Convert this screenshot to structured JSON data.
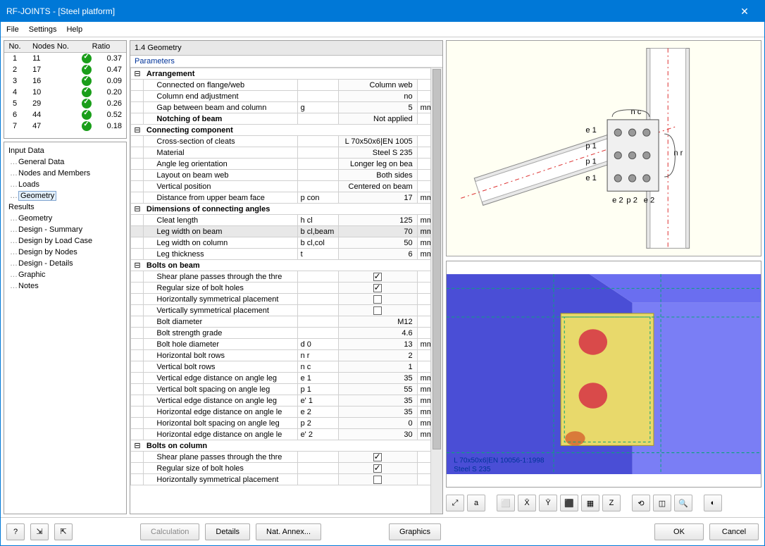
{
  "title": "RF-JOINTS - [Steel platform]",
  "close": "✕",
  "menu": {
    "file": "File",
    "settings": "Settings",
    "help": "Help"
  },
  "nodes_header": {
    "no": "No.",
    "nodes": "Nodes No.",
    "ratio": "Ratio"
  },
  "nodes": [
    {
      "no": "1",
      "nn": "11",
      "ratio": "0.37"
    },
    {
      "no": "2",
      "nn": "17",
      "ratio": "0.47"
    },
    {
      "no": "3",
      "nn": "16",
      "ratio": "0.09"
    },
    {
      "no": "4",
      "nn": "10",
      "ratio": "0.20"
    },
    {
      "no": "5",
      "nn": "29",
      "ratio": "0.26"
    },
    {
      "no": "6",
      "nn": "44",
      "ratio": "0.52"
    },
    {
      "no": "7",
      "nn": "47",
      "ratio": "0.18"
    }
  ],
  "tree": {
    "input": "Input Data",
    "input_items": [
      "General Data",
      "Nodes and Members",
      "Loads",
      "Geometry"
    ],
    "results": "Results",
    "result_items": [
      "Geometry",
      "Design - Summary",
      "Design by Load Case",
      "Design by Nodes",
      "Design - Details",
      "Graphic",
      "Notes"
    ],
    "selected": "Geometry"
  },
  "section_title": "1.4 Geometry",
  "params_label": "Parameters",
  "rows": [
    {
      "type": "group",
      "label": "Arrangement"
    },
    {
      "type": "row",
      "label": "Connected on flange/web",
      "sym": "",
      "val": "Column web",
      "unit": ""
    },
    {
      "type": "row",
      "label": "Column end adjustment",
      "sym": "",
      "val": "no",
      "unit": ""
    },
    {
      "type": "row",
      "label": "Gap between beam and column",
      "sym": "g",
      "val": "5",
      "unit": "mm"
    },
    {
      "type": "row",
      "label": "Notching of beam",
      "bold": true,
      "sym": "",
      "val": "Not applied",
      "unit": ""
    },
    {
      "type": "group",
      "label": "Connecting component"
    },
    {
      "type": "row",
      "label": "Cross-section of cleats",
      "sym": "",
      "val": "L 70x50x6|EN 1005",
      "unit": ""
    },
    {
      "type": "row",
      "label": "Material",
      "sym": "",
      "val": "Steel S 235",
      "unit": ""
    },
    {
      "type": "row",
      "label": "Angle leg orientation",
      "sym": "",
      "val": "Longer leg on bea",
      "unit": ""
    },
    {
      "type": "row",
      "label": "Layout on beam web",
      "sym": "",
      "val": "Both sides",
      "unit": ""
    },
    {
      "type": "row",
      "label": "Vertical position",
      "sym": "",
      "val": "Centered on beam",
      "unit": ""
    },
    {
      "type": "row",
      "label": "Distance from upper beam face",
      "sym": "p con",
      "val": "17",
      "unit": "mm"
    },
    {
      "type": "group",
      "label": "Dimensions of connecting angles"
    },
    {
      "type": "row",
      "label": "Cleat length",
      "sym": "h cl",
      "val": "125",
      "unit": "mm"
    },
    {
      "type": "row",
      "label": "Leg width on beam",
      "sym": "b cl,beam",
      "val": "70",
      "unit": "mm",
      "hl": true
    },
    {
      "type": "row",
      "label": "Leg width on column",
      "sym": "b cl,col",
      "val": "50",
      "unit": "mm"
    },
    {
      "type": "row",
      "label": "Leg thickness",
      "sym": "t",
      "val": "6",
      "unit": "mm"
    },
    {
      "type": "group",
      "label": "Bolts on beam"
    },
    {
      "type": "check",
      "label": "Shear plane passes through the thre",
      "checked": true
    },
    {
      "type": "check",
      "label": "Regular size of bolt holes",
      "checked": true
    },
    {
      "type": "check",
      "label": "Horizontally symmetrical placement",
      "checked": false
    },
    {
      "type": "check",
      "label": "Vertically symmetrical placement",
      "checked": false
    },
    {
      "type": "row",
      "label": "Bolt diameter",
      "sym": "",
      "val": "M12",
      "unit": ""
    },
    {
      "type": "row",
      "label": "Bolt strength grade",
      "sym": "",
      "val": "4.6",
      "unit": ""
    },
    {
      "type": "row",
      "label": "Bolt hole diameter",
      "sym": "d 0",
      "val": "13",
      "unit": "mm"
    },
    {
      "type": "row",
      "label": "Horizontal bolt rows",
      "sym": "n r",
      "val": "2",
      "unit": ""
    },
    {
      "type": "row",
      "label": "Vertical bolt rows",
      "sym": "n c",
      "val": "1",
      "unit": ""
    },
    {
      "type": "row",
      "label": "Vertical edge distance on angle leg",
      "sym": "e 1",
      "val": "35",
      "unit": "mm"
    },
    {
      "type": "row",
      "label": "Vertical bolt spacing on angle leg",
      "sym": "p 1",
      "val": "55",
      "unit": "mm"
    },
    {
      "type": "row",
      "label": "Vertical edge distance on angle leg",
      "sym": "e' 1",
      "val": "35",
      "unit": "mm"
    },
    {
      "type": "row",
      "label": "Horizontal edge distance on angle le",
      "sym": "e 2",
      "val": "35",
      "unit": "mm"
    },
    {
      "type": "row",
      "label": "Horizontal bolt spacing on angle leg",
      "sym": "p 2",
      "val": "0",
      "unit": "mm"
    },
    {
      "type": "row",
      "label": "Horizontal edge distance on angle le",
      "sym": "e' 2",
      "val": "30",
      "unit": "mm"
    },
    {
      "type": "group",
      "label": "Bolts on column"
    },
    {
      "type": "check",
      "label": "Shear plane passes through the thre",
      "checked": true
    },
    {
      "type": "check",
      "label": "Regular size of bolt holes",
      "checked": true
    },
    {
      "type": "check",
      "label": "Horizontally symmetrical placement",
      "checked": false
    }
  ],
  "diagram_labels": {
    "nc": "n c",
    "nr": "n r",
    "e1": "e 1",
    "p1": "p 1",
    "e1b": "e 1",
    "e2": "e 2",
    "p2": "p 2",
    "e2b": "e 2"
  },
  "render_info": {
    "l1": "L 70x50x6|EN 10056-1:1998",
    "l2": "Steel S 235"
  },
  "render_tb": [
    "⤢",
    "a",
    "⬜",
    "X̄",
    "Ȳ",
    "⬛",
    "▦",
    "Z",
    "⟲",
    "◫",
    "🔍",
    "◐"
  ],
  "footer": {
    "calc": "Calculation",
    "details": "Details",
    "annex": "Nat. Annex...",
    "graphics": "Graphics",
    "ok": "OK",
    "cancel": "Cancel"
  }
}
